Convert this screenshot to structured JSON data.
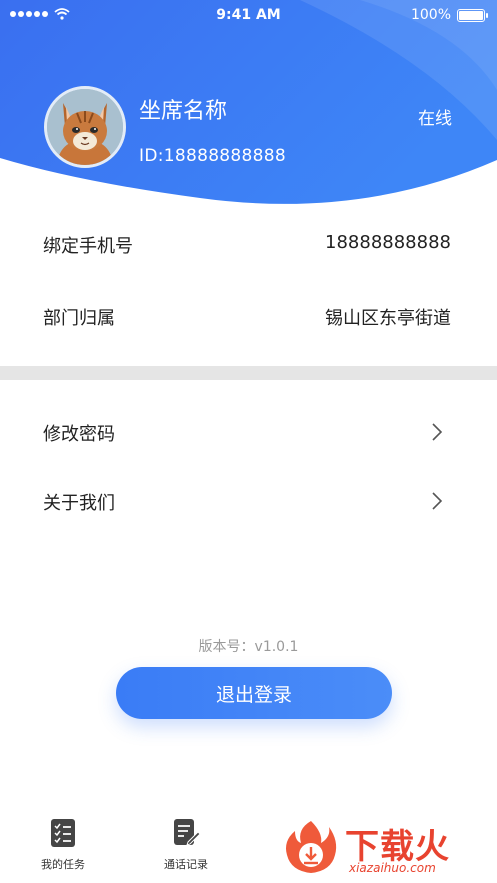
{
  "status_bar": {
    "time": "9:41 AM",
    "battery": "100%"
  },
  "profile": {
    "name": "坐席名称",
    "id": "ID:18888888888",
    "status": "在线"
  },
  "info_rows": [
    {
      "label": "绑定手机号",
      "value": "18888888888"
    },
    {
      "label": "部门归属",
      "value": "锡山区东亭街道"
    }
  ],
  "menu_rows": [
    {
      "label": "修改密码"
    },
    {
      "label": "关于我们"
    }
  ],
  "version": "版本号：v1.0.1",
  "logout_label": "退出登录",
  "tabs": [
    {
      "label": "我的任务",
      "icon": "task-list-icon"
    },
    {
      "label": "通话记录",
      "icon": "call-record-icon"
    }
  ],
  "watermark": {
    "title": "下载火",
    "subtitle": "xiazaihuo.com"
  },
  "colors": {
    "header_blue": "#3a7cf6",
    "watermark_red": "#e8432f"
  }
}
